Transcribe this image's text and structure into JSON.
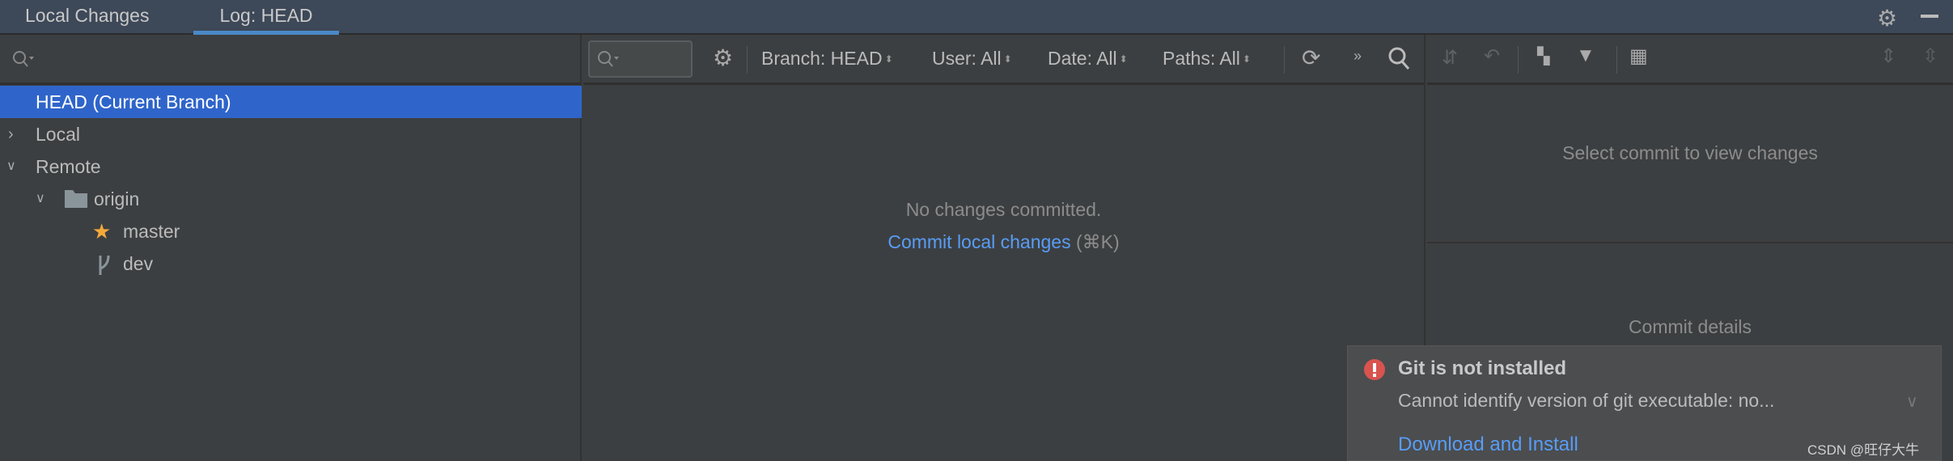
{
  "tabs": [
    {
      "label": "Local Changes",
      "active": false
    },
    {
      "label": "Log: HEAD",
      "active": true
    }
  ],
  "branch_tree": {
    "search_icon": "search-icon",
    "items": [
      {
        "label": "HEAD (Current Branch)",
        "selected": true
      },
      {
        "label": "Local",
        "expanded": false
      },
      {
        "label": "Remote",
        "expanded": true
      },
      {
        "label": "origin",
        "icon": "folder-icon",
        "expanded": true
      },
      {
        "label": "master",
        "icon": "star-icon"
      },
      {
        "label": "dev",
        "icon": "branch-icon"
      }
    ]
  },
  "log_toolbar": {
    "filters": {
      "branch": "Branch: HEAD",
      "user": "User: All",
      "date": "Date: All",
      "paths": "Paths: All"
    },
    "more": "»"
  },
  "log": {
    "empty_text": "No changes committed.",
    "commit_link": "Commit local changes",
    "shortcut": "(⌘K)"
  },
  "changes": {
    "empty_text": "Select commit to view changes"
  },
  "details": {
    "empty_text": "Commit details"
  },
  "notification": {
    "title": "Git is not installed",
    "message": "Cannot identify version of git executable: no...",
    "action": "Download and Install"
  },
  "watermark": "CSDN @旺仔大牛",
  "colors": {
    "accent": "#2f65ca",
    "link": "#589df6",
    "error": "#d9534f",
    "star": "#f4a93b"
  }
}
